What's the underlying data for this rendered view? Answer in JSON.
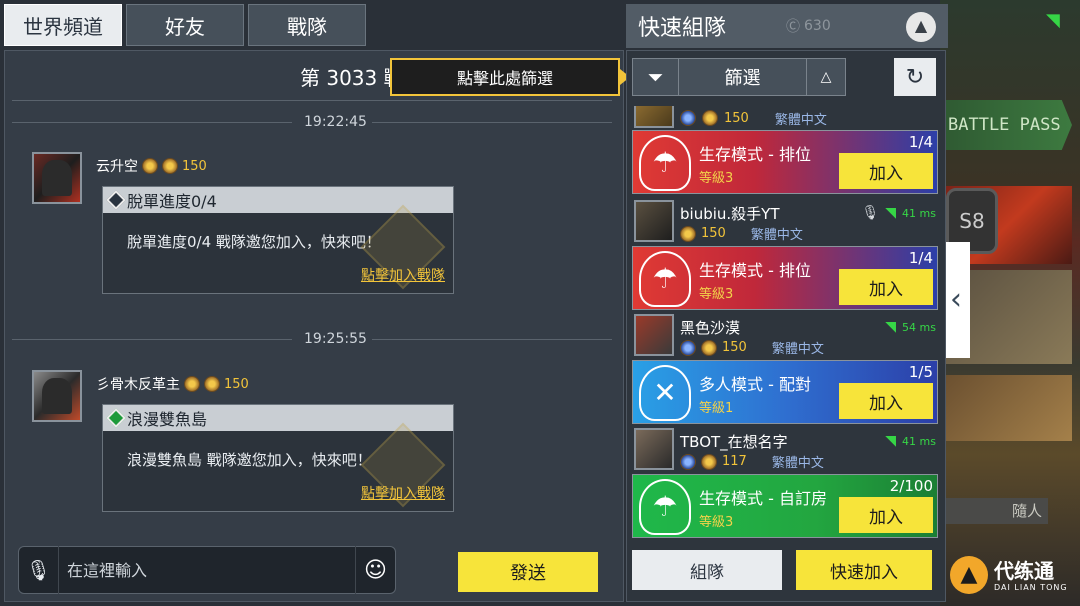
{
  "tabs": [
    {
      "label": "世界頻道",
      "active": true
    },
    {
      "label": "好友",
      "active": false
    },
    {
      "label": "戰隊",
      "active": false
    }
  ],
  "chat": {
    "server_title": "第 3033 戰區",
    "filter_tip": "點擊此處篩選",
    "messages": [
      {
        "time": "19:22:45",
        "username": "云升空",
        "rank_points": "150",
        "bubble_title": "脫單進度0/4",
        "bubble_text": "脫單進度0/4 戰隊邀您加入，快來吧！",
        "bubble_link": "點擊加入戰隊"
      },
      {
        "time": "19:25:55",
        "username": "彡骨木反革主",
        "rank_points": "150",
        "bubble_title": "浪漫雙魚島",
        "bubble_text": "浪漫雙魚島 戰隊邀您加入，快來吧！",
        "bubble_link": "點擊加入戰隊"
      }
    ],
    "input_placeholder": "在這裡輸入",
    "send_label": "發送"
  },
  "quick_team": {
    "title": "快速組隊",
    "coin": "630",
    "filter_label": "篩選",
    "partial_top": {
      "points": "150",
      "lang": "繁體中文"
    },
    "teams": [
      {
        "name": "",
        "points": "150",
        "lang": "繁體中文",
        "ping": "",
        "mode": "生存模式 - 排位",
        "level": "等級3",
        "count": "1/4",
        "color": "red",
        "join_label": "加入",
        "show_header": false
      },
      {
        "name": "biubiu.殺手YT",
        "points": "150",
        "lang": "繁體中文",
        "ping": "41 ms",
        "mode": "生存模式 - 排位",
        "level": "等級3",
        "count": "1/4",
        "color": "red",
        "join_label": "加入",
        "show_header": true
      },
      {
        "name": "黑色沙漠",
        "points": "150",
        "lang": "繁體中文",
        "ping": "54 ms",
        "mode": "多人模式 - 配對",
        "level": "等級1",
        "count": "1/5",
        "color": "blue",
        "join_label": "加入",
        "show_header": true
      },
      {
        "name": "TBOT_在想名字",
        "points": "117",
        "lang": "繁體中文",
        "ping": "41 ms",
        "mode": "生存模式 - 自訂房",
        "level": "等級3",
        "count": "2/100",
        "color": "green",
        "join_label": "加入",
        "show_header": true
      }
    ],
    "team_button": "組隊",
    "quick_join_button": "快速加入"
  },
  "background": {
    "battle_pass": "BATTLE PASS",
    "badge": "S8",
    "join_strip": "隨人"
  },
  "logo": {
    "big": "代练通",
    "small": "DAI LIAN TONG"
  },
  "colors": {
    "accent_yellow": "#f7e43a",
    "gold": "#f2c43a",
    "ping_green": "#36d646"
  }
}
